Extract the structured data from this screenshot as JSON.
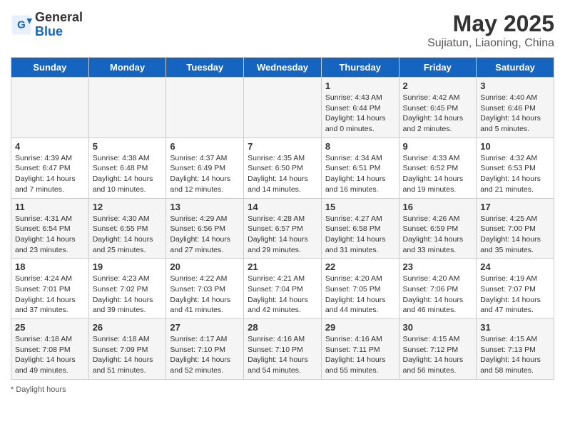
{
  "header": {
    "logo_general": "General",
    "logo_blue": "Blue",
    "main_title": "May 2025",
    "subtitle": "Sujiatun, Liaoning, China"
  },
  "days_of_week": [
    "Sunday",
    "Monday",
    "Tuesday",
    "Wednesday",
    "Thursday",
    "Friday",
    "Saturday"
  ],
  "weeks": [
    [
      {
        "day": "",
        "info": ""
      },
      {
        "day": "",
        "info": ""
      },
      {
        "day": "",
        "info": ""
      },
      {
        "day": "",
        "info": ""
      },
      {
        "day": "1",
        "info": "Sunrise: 4:43 AM\nSunset: 6:44 PM\nDaylight: 14 hours\nand 0 minutes."
      },
      {
        "day": "2",
        "info": "Sunrise: 4:42 AM\nSunset: 6:45 PM\nDaylight: 14 hours\nand 2 minutes."
      },
      {
        "day": "3",
        "info": "Sunrise: 4:40 AM\nSunset: 6:46 PM\nDaylight: 14 hours\nand 5 minutes."
      }
    ],
    [
      {
        "day": "4",
        "info": "Sunrise: 4:39 AM\nSunset: 6:47 PM\nDaylight: 14 hours\nand 7 minutes."
      },
      {
        "day": "5",
        "info": "Sunrise: 4:38 AM\nSunset: 6:48 PM\nDaylight: 14 hours\nand 10 minutes."
      },
      {
        "day": "6",
        "info": "Sunrise: 4:37 AM\nSunset: 6:49 PM\nDaylight: 14 hours\nand 12 minutes."
      },
      {
        "day": "7",
        "info": "Sunrise: 4:35 AM\nSunset: 6:50 PM\nDaylight: 14 hours\nand 14 minutes."
      },
      {
        "day": "8",
        "info": "Sunrise: 4:34 AM\nSunset: 6:51 PM\nDaylight: 14 hours\nand 16 minutes."
      },
      {
        "day": "9",
        "info": "Sunrise: 4:33 AM\nSunset: 6:52 PM\nDaylight: 14 hours\nand 19 minutes."
      },
      {
        "day": "10",
        "info": "Sunrise: 4:32 AM\nSunset: 6:53 PM\nDaylight: 14 hours\nand 21 minutes."
      }
    ],
    [
      {
        "day": "11",
        "info": "Sunrise: 4:31 AM\nSunset: 6:54 PM\nDaylight: 14 hours\nand 23 minutes."
      },
      {
        "day": "12",
        "info": "Sunrise: 4:30 AM\nSunset: 6:55 PM\nDaylight: 14 hours\nand 25 minutes."
      },
      {
        "day": "13",
        "info": "Sunrise: 4:29 AM\nSunset: 6:56 PM\nDaylight: 14 hours\nand 27 minutes."
      },
      {
        "day": "14",
        "info": "Sunrise: 4:28 AM\nSunset: 6:57 PM\nDaylight: 14 hours\nand 29 minutes."
      },
      {
        "day": "15",
        "info": "Sunrise: 4:27 AM\nSunset: 6:58 PM\nDaylight: 14 hours\nand 31 minutes."
      },
      {
        "day": "16",
        "info": "Sunrise: 4:26 AM\nSunset: 6:59 PM\nDaylight: 14 hours\nand 33 minutes."
      },
      {
        "day": "17",
        "info": "Sunrise: 4:25 AM\nSunset: 7:00 PM\nDaylight: 14 hours\nand 35 minutes."
      }
    ],
    [
      {
        "day": "18",
        "info": "Sunrise: 4:24 AM\nSunset: 7:01 PM\nDaylight: 14 hours\nand 37 minutes."
      },
      {
        "day": "19",
        "info": "Sunrise: 4:23 AM\nSunset: 7:02 PM\nDaylight: 14 hours\nand 39 minutes."
      },
      {
        "day": "20",
        "info": "Sunrise: 4:22 AM\nSunset: 7:03 PM\nDaylight: 14 hours\nand 41 minutes."
      },
      {
        "day": "21",
        "info": "Sunrise: 4:21 AM\nSunset: 7:04 PM\nDaylight: 14 hours\nand 42 minutes."
      },
      {
        "day": "22",
        "info": "Sunrise: 4:20 AM\nSunset: 7:05 PM\nDaylight: 14 hours\nand 44 minutes."
      },
      {
        "day": "23",
        "info": "Sunrise: 4:20 AM\nSunset: 7:06 PM\nDaylight: 14 hours\nand 46 minutes."
      },
      {
        "day": "24",
        "info": "Sunrise: 4:19 AM\nSunset: 7:07 PM\nDaylight: 14 hours\nand 47 minutes."
      }
    ],
    [
      {
        "day": "25",
        "info": "Sunrise: 4:18 AM\nSunset: 7:08 PM\nDaylight: 14 hours\nand 49 minutes."
      },
      {
        "day": "26",
        "info": "Sunrise: 4:18 AM\nSunset: 7:09 PM\nDaylight: 14 hours\nand 51 minutes."
      },
      {
        "day": "27",
        "info": "Sunrise: 4:17 AM\nSunset: 7:10 PM\nDaylight: 14 hours\nand 52 minutes."
      },
      {
        "day": "28",
        "info": "Sunrise: 4:16 AM\nSunset: 7:10 PM\nDaylight: 14 hours\nand 54 minutes."
      },
      {
        "day": "29",
        "info": "Sunrise: 4:16 AM\nSunset: 7:11 PM\nDaylight: 14 hours\nand 55 minutes."
      },
      {
        "day": "30",
        "info": "Sunrise: 4:15 AM\nSunset: 7:12 PM\nDaylight: 14 hours\nand 56 minutes."
      },
      {
        "day": "31",
        "info": "Sunrise: 4:15 AM\nSunset: 7:13 PM\nDaylight: 14 hours\nand 58 minutes."
      }
    ]
  ],
  "footer": {
    "note": "Daylight hours"
  }
}
